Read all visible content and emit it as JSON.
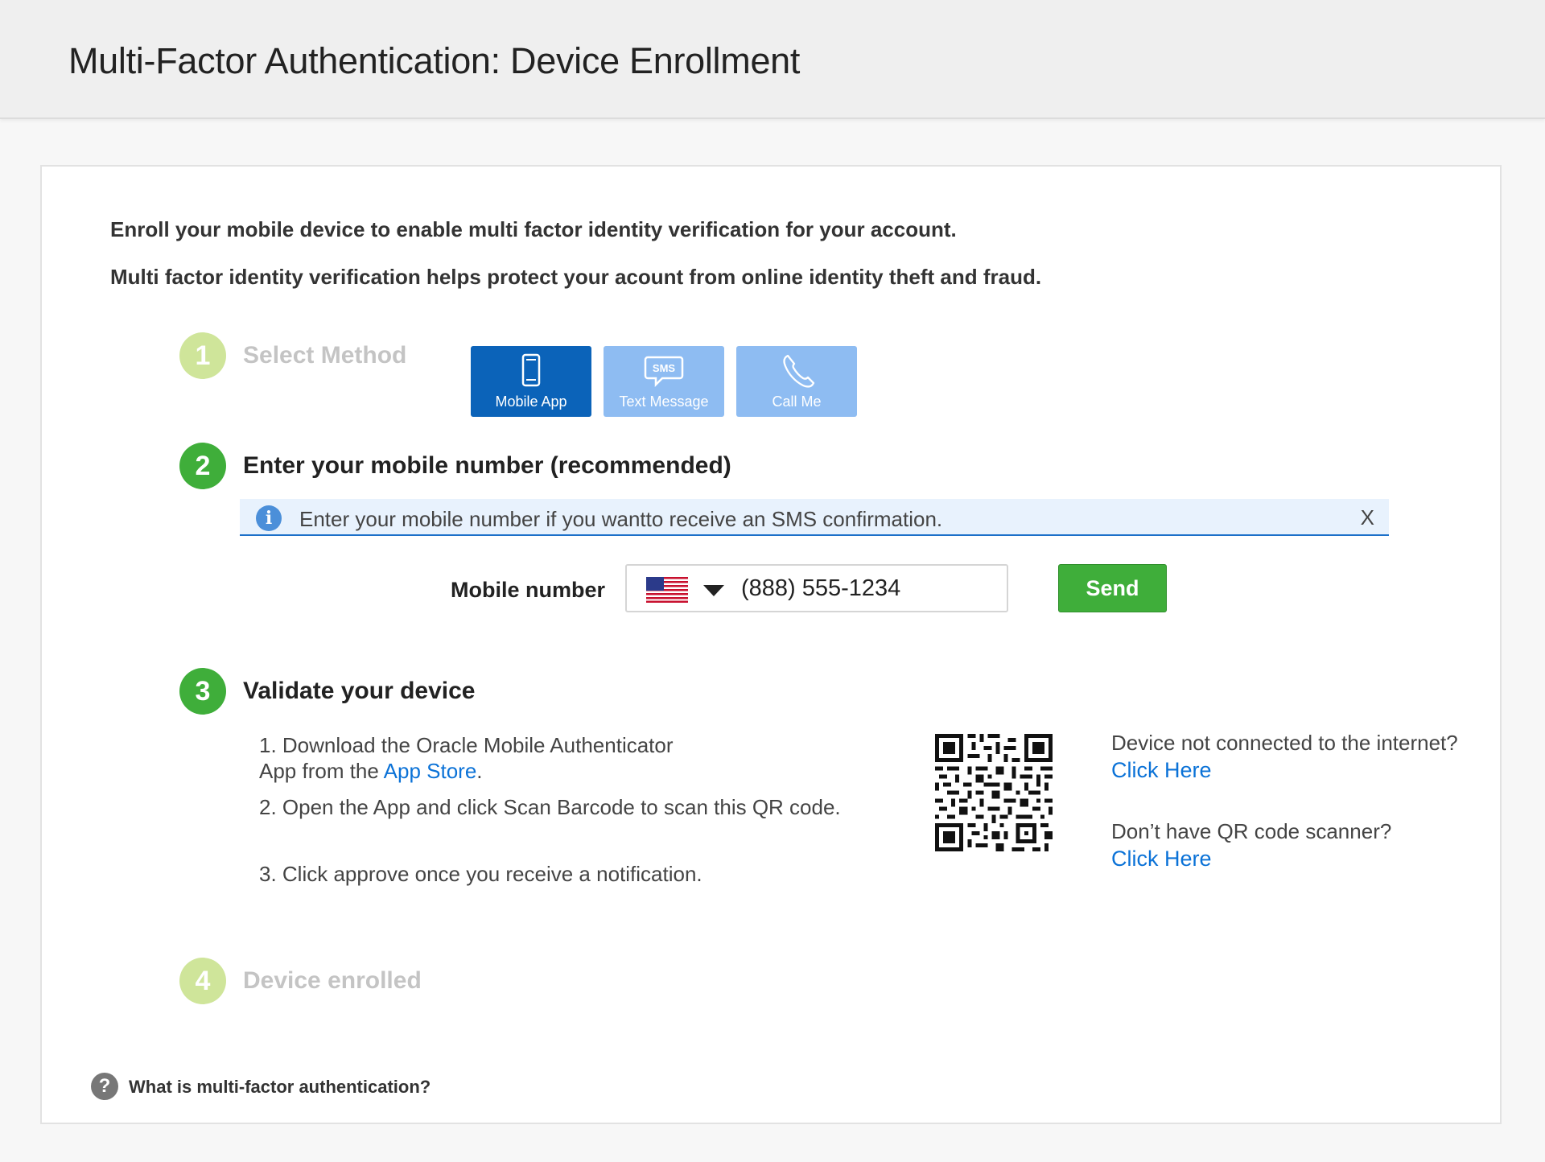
{
  "header": {
    "title": "Multi-Factor Authentication: Device Enrollment"
  },
  "intro": {
    "line1": "Enroll your mobile device to enable multi factor identity verification for your account.",
    "line2": "Multi factor identity verification helps protect your acount from online identity theft and fraud."
  },
  "steps": [
    {
      "number": "1",
      "title": "Select Method",
      "state": "done"
    },
    {
      "number": "2",
      "title": "Enter your mobile number (recommended)",
      "state": "active"
    },
    {
      "number": "3",
      "title": "Validate your device",
      "state": "active"
    },
    {
      "number": "4",
      "title": "Device enrolled",
      "state": "done"
    }
  ],
  "methods": [
    {
      "label": "Mobile App",
      "icon": "mobile-phone-icon",
      "selected": true
    },
    {
      "label": "Text Message",
      "icon": "sms-bubble-icon",
      "icon_text": "SMS",
      "selected": false
    },
    {
      "label": "Call Me",
      "icon": "phone-handset-icon",
      "selected": false
    }
  ],
  "info": {
    "text": "Enter your mobile number if you wantto receive an SMS confirmation.",
    "close": "X"
  },
  "mobile": {
    "label": "Mobile number",
    "country": "us-flag-icon",
    "value": "(888) 555-1234",
    "send": "Send"
  },
  "validate": {
    "step1_a": "1. Download the Oracle Mobile Authenticator",
    "step1_b": "App from the ",
    "step1_link": "App Store",
    "step1_end": ".",
    "step2": "2. Open the App and click Scan Barcode to  scan this QR code.",
    "step3": "3. Click approve once you receive a notification."
  },
  "side": {
    "q1": "Device not connected to the internet?",
    "link1": "Click Here",
    "q2": "Don’t have QR code scanner?",
    "link2": "Click Here"
  },
  "help": {
    "icon": "question-icon",
    "text": "What is multi-factor authentication?"
  },
  "colors": {
    "primary": "#0b63b9",
    "primary_light": "#8ebcf2",
    "success": "#3fae3a",
    "step_done": "#cfe59a",
    "link": "#0b72d7"
  }
}
